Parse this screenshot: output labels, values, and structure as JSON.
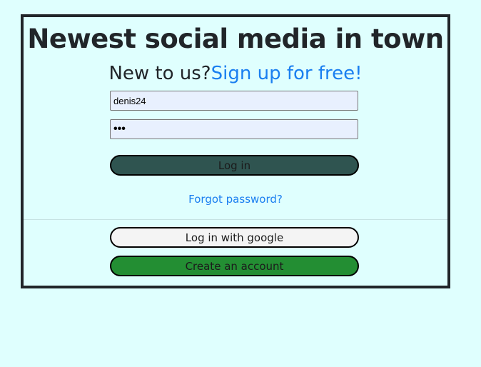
{
  "header": {
    "title": "Newest social media in town",
    "signup_prompt": "New to us?",
    "signup_link": "Sign up for free!"
  },
  "form": {
    "username_value": "denis24",
    "password_value": "•••",
    "login_label": "Log in",
    "forgot_label": "Forgot password?"
  },
  "alternatives": {
    "google_label": "Log in with google",
    "create_label": "Create an account"
  },
  "colors": {
    "background": "#dffffe",
    "link": "#1a7ff0",
    "login_button": "#2f5450",
    "create_button": "#238e33"
  }
}
